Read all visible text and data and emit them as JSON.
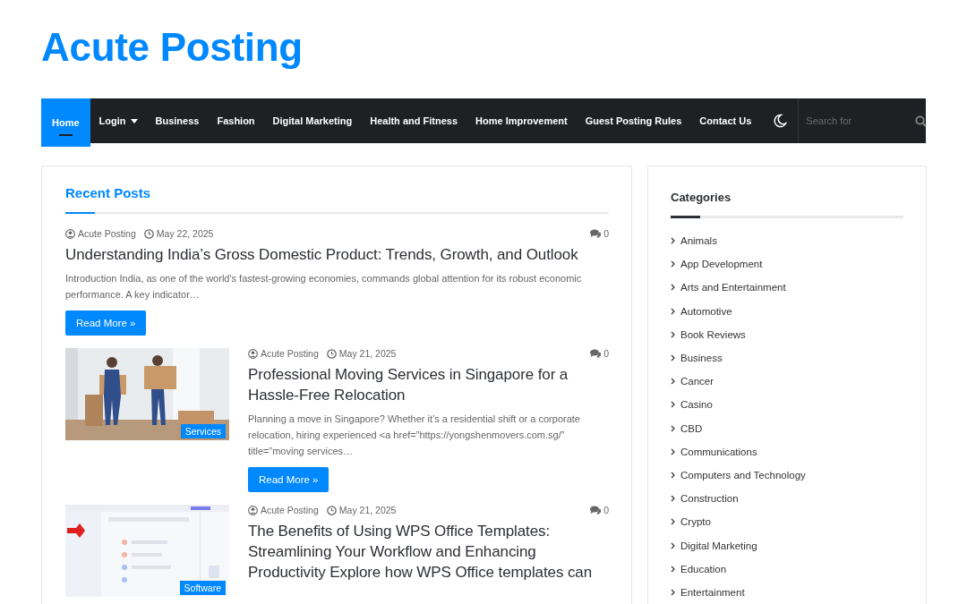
{
  "site": {
    "title": "Acute Posting"
  },
  "nav": {
    "items": [
      {
        "label": "Home",
        "selected": true,
        "dropdown": false
      },
      {
        "label": "Login",
        "selected": false,
        "dropdown": true
      },
      {
        "label": "Business",
        "selected": false,
        "dropdown": false
      },
      {
        "label": "Fashion",
        "selected": false,
        "dropdown": false
      },
      {
        "label": "Digital Marketing",
        "selected": false,
        "dropdown": false
      },
      {
        "label": "Health and Fitness",
        "selected": false,
        "dropdown": false
      },
      {
        "label": "Home Improvement",
        "selected": false,
        "dropdown": false
      },
      {
        "label": "Guest Posting Rules",
        "selected": false,
        "dropdown": false
      },
      {
        "label": "Contact Us",
        "selected": false,
        "dropdown": false
      }
    ],
    "search": {
      "placeholder": "Search for"
    }
  },
  "recent_posts": {
    "title": "Recent Posts",
    "posts": [
      {
        "author": "Acute Posting",
        "date": "May 22, 2025",
        "comments": "0",
        "title": "Understanding India’s Gross Domestic Product: Trends, Growth, and Outlook",
        "excerpt": "Introduction India, as one of the world's fastest-growing economies, commands global attention for its robust economic performance. A key indicator…",
        "button": "Read More »"
      },
      {
        "author": "Acute Posting",
        "date": "May 21, 2025",
        "comments": "0",
        "title": "Professional Moving Services in Singapore for a Hassle-Free Relocation",
        "excerpt": "Planning a move in Singapore? Whether it’s a residential shift or a corporate relocation, hiring experienced <a href=”https://yongshenmovers.com.sg/” title=”moving services…",
        "button": "Read More »",
        "image": {
          "kind": "movers",
          "badge": "Services"
        }
      },
      {
        "author": "Acute Posting",
        "date": "May 21, 2025",
        "comments": "0",
        "title": "The Benefits of Using WPS Office Templates: Streamlining Your Workflow and Enhancing Productivity Explore how WPS Office templates can",
        "image": {
          "kind": "app",
          "badge": "Software"
        }
      }
    ]
  },
  "sidebar": {
    "title": "Categories",
    "items": [
      "Animals",
      "App Development",
      "Arts and Entertainment",
      "Automotive",
      "Book Reviews",
      "Business",
      "Cancer",
      "Casino",
      "CBD",
      "Communications",
      "Computers and Technology",
      "Construction",
      "Crypto",
      "Digital Marketing",
      "Education",
      "Entertainment"
    ]
  }
}
